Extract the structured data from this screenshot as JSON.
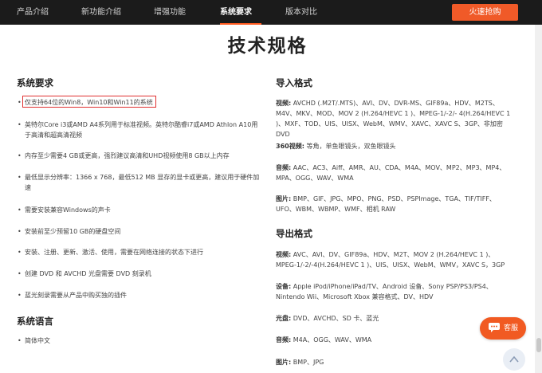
{
  "nav": {
    "items": [
      {
        "label": "产品介绍",
        "active": false
      },
      {
        "label": "新功能介绍",
        "active": false
      },
      {
        "label": "增强功能",
        "active": false
      },
      {
        "label": "系统要求",
        "active": true
      },
      {
        "label": "版本对比",
        "active": false
      }
    ],
    "buy_label": "火速抢购"
  },
  "page_title": "技术规格",
  "system_requirements": {
    "title": "系统要求",
    "items": [
      "仅支持64位的Win8，Win10和Win11的系统",
      "英特尔Core i3或AMD A4系列用于标准视频。英特尔酷睿i7或AMD Athlon A10用于高清和超高清视频",
      "内存至少需要4 GB或更高，强烈建议高清和UHD视频使用8 GB以上内存",
      "最低显示分辨率：1366 x 768，最低512 MB 显存的显卡或更高，建议用于硬件加速",
      "需要安装兼容Windows的声卡",
      "安装前至少预留10 GB的硬盘空间",
      "安装、注册、更新、激活、使用，需要在网络连接的状态下进行",
      "创建 DVD 和 AVCHD 光盘需要 DVD 刻录机",
      "蓝光刻录需要从产品中购买独的插件"
    ]
  },
  "system_language": {
    "title": "系统语言",
    "items": [
      "简体中文"
    ]
  },
  "import_formats": {
    "title": "导入格式",
    "rows": [
      {
        "label": "视频:",
        "value": "AVCHD (.M2T/.MTS)、AVI、DV、DVR-MS、GIF89a、HDV、M2TS、M4V、MKV、MOD、MOV 2 (H.264/HEVC 1 )、MPEG-1/-2/- 4(H.264/HEVC 1 )、MXF、TOD、UIS、UISX、WebM、WMV、XAVC、XAVC S、3GP、非加密 DVD"
      },
      {
        "label": "360视频:",
        "value": "等角，单鱼眼镜头，双鱼眼镜头"
      },
      {
        "label": "音频:",
        "value": "AAC、AC3、Aiff、AMR、AU、CDA、M4A、MOV、MP2、MP3、MP4、MPA、OGG、WAV、WMA"
      },
      {
        "label": "图片:",
        "value": "BMP、GIF、JPG、MPO、PNG、PSD、PSPImage、TGA、TIF/TIFF、UFO、WBM、WBMP、WMF、相机 RAW"
      }
    ]
  },
  "export_formats": {
    "title": "导出格式",
    "rows": [
      {
        "label": "视频:",
        "value": "AVC、AVI、DV、GIF89a、HDV、M2T、MOV 2 (H.264/HEVC 1 )、MPEG-1/-2/-4(H.264/HEVC 1 )、UIS、UISX、WebM、WMV，XAVC S，3GP"
      },
      {
        "label": "设备:",
        "value": "Apple iPod/iPhone/iPad/TV、Android 设备、Sony PSP/PS3/PS4、Nintendo Wii、Microsoft Xbox 兼容格式、DV、HDV"
      },
      {
        "label": "光盘:",
        "value": "DVD、AVCHD、SD 卡、蓝光"
      },
      {
        "label": "音频:",
        "value": "M4A、OGG、WAV、WMA"
      },
      {
        "label": "图片:",
        "value": "BMP、JPG"
      }
    ]
  },
  "chat": {
    "label": "客服"
  },
  "colors": {
    "accent": "#f05a28",
    "nav_bg": "#1b1b1b",
    "highlight": "#e03131"
  },
  "icons": [
    "chat-bubble-icon",
    "arrow-up-icon"
  ]
}
